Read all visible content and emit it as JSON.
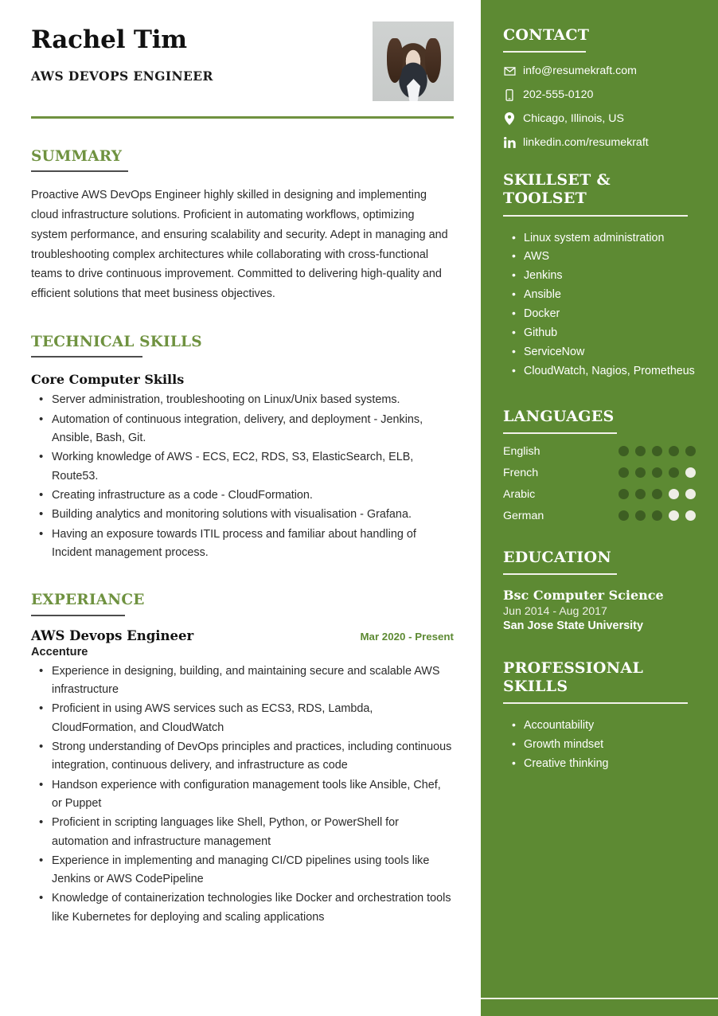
{
  "colors": {
    "sidebar_green": "#5D8A33",
    "heading_green": "#6F9240",
    "dot_filled": "#3D5E22",
    "dot_empty": "#EEEEE6",
    "rule_dark": "#4D4D4D"
  },
  "header": {
    "name": "Rachel Tim",
    "job_title": "AWS DEVOPS ENGINEER",
    "photo_alt": "profile-photo"
  },
  "summary": {
    "title": "SUMMARY",
    "text": "Proactive AWS DevOps Engineer highly skilled in designing and implementing cloud infrastructure solutions. Proficient in automating workflows, optimizing system performance, and ensuring scalability and security. Adept in managing and troubleshooting complex architectures while collaborating with cross-functional teams to drive continuous improvement. Committed to delivering high-quality and efficient solutions that meet business objectives."
  },
  "technical_skills": {
    "title": "TECHNICAL SKILLS",
    "subheading": "Core Computer Skills",
    "items": [
      "Server administration, troubleshooting on Linux/Unix based systems.",
      "Automation of continuous integration, delivery, and deployment - Jenkins, Ansible, Bash, Git.",
      "Working knowledge of AWS - ECS, EC2, RDS, S3, ElasticSearch, ELB, Route53.",
      "Creating infrastructure as a code - CloudFormation.",
      "Building analytics and monitoring solutions with visualisation - Grafana.",
      "Having an exposure towards ITIL process and familiar about handling of Incident management process."
    ]
  },
  "experience": {
    "title": "EXPERIANCE",
    "entries": [
      {
        "role": "AWS Devops Engineer",
        "dates": "Mar 2020 - Present",
        "company": "Accenture",
        "bullets": [
          "Experience in designing, building, and maintaining secure and scalable AWS infrastructure",
          "Proficient in using AWS services such as ECS3, RDS, Lambda, CloudFormation, and CloudWatch",
          "Strong understanding of DevOps principles and practices, including continuous integration, continuous delivery, and infrastructure as code",
          "Handson experience with configuration management tools like Ansible, Chef, or Puppet",
          "Proficient in scripting languages like Shell, Python, or PowerShell for automation and infrastructure management",
          "Experience in implementing and managing CI/CD pipelines using tools like Jenkins or AWS CodePipeline",
          "Knowledge of containerization technologies like Docker and orchestration tools like Kubernetes for deploying and scaling applications"
        ]
      }
    ]
  },
  "sidebar": {
    "contact": {
      "title": "CONTACT",
      "items": [
        {
          "icon": "envelope-icon",
          "value": "info@resumekraft.com"
        },
        {
          "icon": "mobile-phone-icon",
          "value": "202-555-0120"
        },
        {
          "icon": "location-pin-icon",
          "value": "Chicago, Illinois, US"
        },
        {
          "icon": "linkedin-icon",
          "value": "linkedin.com/resumekraft"
        }
      ]
    },
    "skillset": {
      "title": "SKILLSET & TOOLSET",
      "items": [
        "Linux system administration",
        "AWS",
        "Jenkins",
        "Ansible",
        "Docker",
        "Github",
        "ServiceNow",
        "CloudWatch, Nagios, Prometheus"
      ]
    },
    "languages": {
      "title": "LANGUAGES",
      "max_level": 5,
      "items": [
        {
          "name": "English",
          "level": 5
        },
        {
          "name": "French",
          "level": 4
        },
        {
          "name": "Arabic",
          "level": 3
        },
        {
          "name": "German",
          "level": 3
        }
      ]
    },
    "education": {
      "title": "EDUCATION",
      "entries": [
        {
          "degree": "Bsc Computer Science",
          "dates": "Jun 2014 - Aug 2017",
          "school": "San Jose State University"
        }
      ]
    },
    "professional_skills": {
      "title": "PROFESSIONAL SKILLS",
      "items": [
        "Accountability",
        "Growth mindset",
        "Creative thinking"
      ]
    }
  }
}
